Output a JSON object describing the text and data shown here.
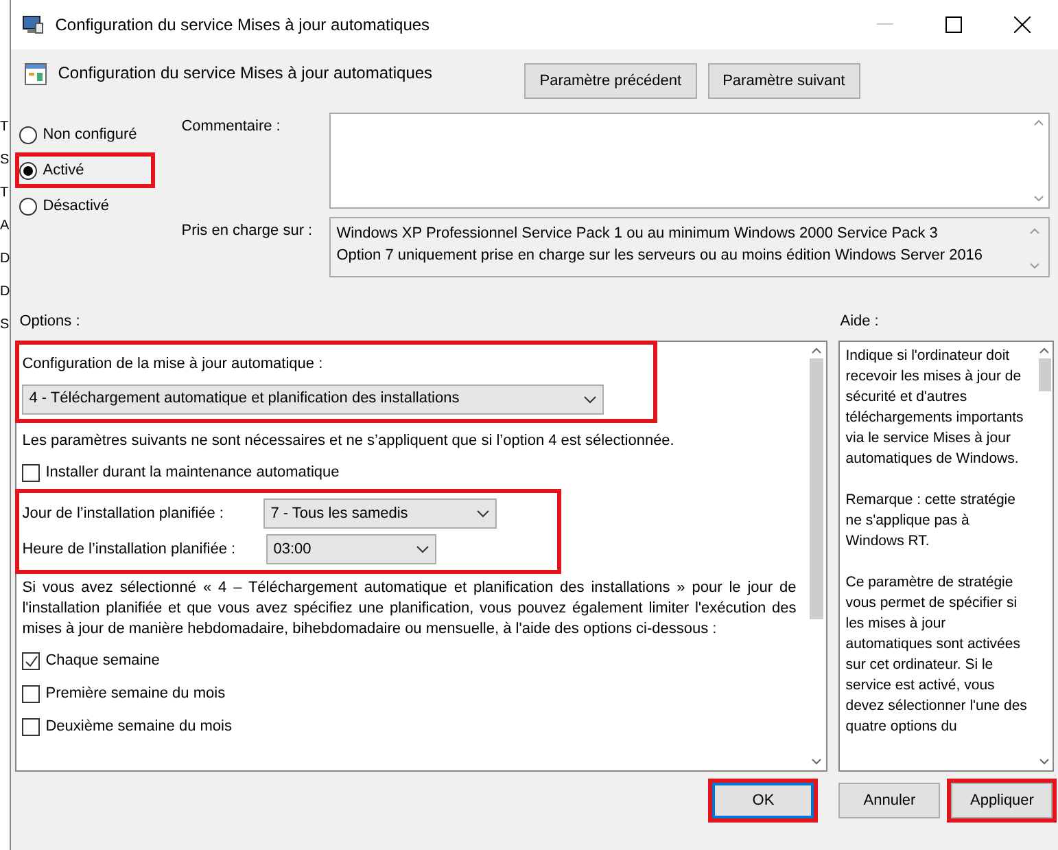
{
  "background_letters": [
    "T",
    "S",
    "T",
    "A",
    "D",
    "D",
    "S"
  ],
  "window": {
    "title": "Configuration du service Mises à jour automatiques"
  },
  "header": {
    "title": "Configuration du service Mises à jour automatiques",
    "buttons": [
      "Paramètre précédent",
      "Paramètre suivant"
    ]
  },
  "state_options": [
    {
      "label": "Non configuré",
      "selected": false,
      "highlighted": false
    },
    {
      "label": "Activé",
      "selected": true,
      "highlighted": true
    },
    {
      "label": "Désactivé",
      "selected": false,
      "highlighted": false
    }
  ],
  "comment": {
    "label": "Commentaire :"
  },
  "supported_on": {
    "label": "Pris en charge sur :",
    "lines": [
      "Windows XP Professionnel Service Pack 1 ou au minimum Windows 2000 Service Pack 3",
      "Option 7 uniquement prise en charge sur les serveurs ou au moins édition Windows Server 2016"
    ]
  },
  "options": {
    "label": "Options :",
    "items": [
      {
        "kind": "dropdown",
        "highlighted": true,
        "label": "Configuration de la mise à jour automatique :",
        "value": "4 - Téléchargement automatique et planification des installations"
      },
      {
        "kind": "note",
        "text": "Les paramètres suivants ne sont nécessaires et ne s’appliquent que si l’option 4 est sélectionnée."
      },
      {
        "kind": "checkbox",
        "label": "Installer durant la maintenance automatique",
        "checked": false
      },
      {
        "kind": "group",
        "highlighted": true,
        "fields": [
          {
            "label": "Jour de l’installation planifiée :",
            "value": "7 - Tous les samedis"
          },
          {
            "label": "Heure de l’installation planifiée :",
            "value": "03:00"
          }
        ]
      },
      {
        "kind": "paragraph",
        "text": "Si vous avez sélectionné « 4 – Téléchargement automatique et planification des installations » pour le jour de l'installation planifiée et que vous avez spécifiez une planification, vous pouvez également limiter l'exécution des mises à jour de manière hebdomadaire, bihebdomadaire ou mensuelle, à l'aide des options ci-dessous :"
      },
      {
        "kind": "checkbox",
        "label": "Chaque semaine",
        "checked": true
      },
      {
        "kind": "checkbox",
        "label": "Première semaine du mois",
        "checked": false
      },
      {
        "kind": "checkbox",
        "label": "Deuxième semaine du mois",
        "checked": false
      }
    ]
  },
  "help": {
    "label": "Aide :",
    "paragraphs": [
      "Indique si l'ordinateur doit recevoir les mises à jour de sécurité et d'autres téléchargements importants via le service Mises à jour automatiques de Windows.",
      "Remarque : cette stratégie ne s'applique pas à Windows RT.",
      "Ce paramètre de stratégie vous permet de spécifier si les mises à jour automatiques sont activées sur cet ordinateur. Si le service est activé, vous devez sélectionner l'une des quatre options du"
    ]
  },
  "footer_buttons": [
    {
      "label": "OK",
      "default": true,
      "highlighted": true
    },
    {
      "label": "Annuler",
      "default": false,
      "highlighted": false
    },
    {
      "label": "Appliquer",
      "default": false,
      "highlighted": true
    }
  ]
}
